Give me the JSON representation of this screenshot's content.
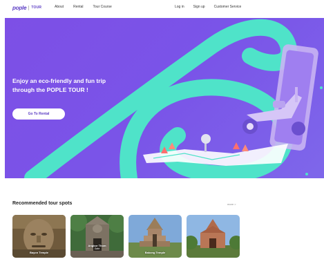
{
  "header": {
    "logo_main": "pople",
    "logo_sub": "TOUR",
    "nav_left": [
      "About",
      "Rental",
      "Tour Course"
    ],
    "nav_right": [
      "Log in",
      "Sign up",
      "Customer Service"
    ]
  },
  "hero": {
    "title_line1": "Enjoy an eco-friendly and fun trip",
    "title_line2": "through the POPLE TOUR !",
    "cta_label": "Go To Rental"
  },
  "recommended": {
    "title": "Recommended tour spots",
    "more_label": "more >",
    "cards": [
      {
        "name": "Bayon Temple",
        "sub": ""
      },
      {
        "name": "Angkor Thom",
        "sub": "Gate"
      },
      {
        "name": "Bakong Temple",
        "sub": ""
      },
      {
        "name": "",
        "sub": ""
      }
    ]
  },
  "colors": {
    "brand_purple": "#5b3cc4",
    "hero_purple": "#7a54e8",
    "accent_teal": "#4fe3c9"
  }
}
